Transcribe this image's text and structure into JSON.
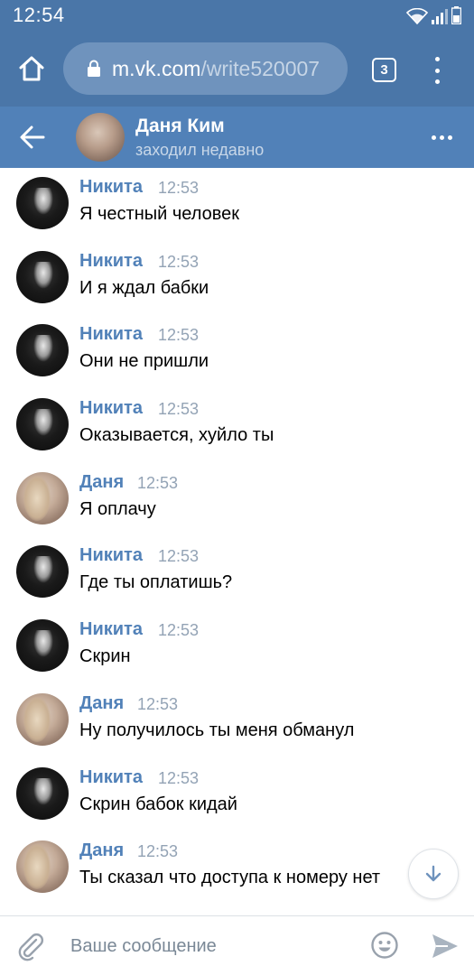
{
  "status_bar": {
    "time": "12:54"
  },
  "browser": {
    "url_host": "m.vk.com",
    "url_path": "/write520007",
    "tab_count": "3"
  },
  "chat_header": {
    "name": "Даня Ким",
    "status": "заходил недавно"
  },
  "messages": [
    {
      "author": "Никита",
      "time": "12:53",
      "text": "Я честный человек",
      "avatar": "nikita"
    },
    {
      "author": "Никита",
      "time": "12:53",
      "text": "И я ждал бабки",
      "avatar": "nikita"
    },
    {
      "author": "Никита",
      "time": "12:53",
      "text": "Они не пришли",
      "avatar": "nikita"
    },
    {
      "author": "Никита",
      "time": "12:53",
      "text": "Оказывается, хуйло ты",
      "avatar": "nikita"
    },
    {
      "author": "Даня",
      "time": "12:53",
      "text": "Я оплачу",
      "avatar": "danya"
    },
    {
      "author": "Никита",
      "time": "12:53",
      "text": "Где ты оплатишь?",
      "avatar": "nikita"
    },
    {
      "author": "Никита",
      "time": "12:53",
      "text": "Скрин",
      "avatar": "nikita"
    },
    {
      "author": "Даня",
      "time": "12:53",
      "text": "Ну получилось ты меня обманул",
      "avatar": "danya"
    },
    {
      "author": "Никита",
      "time": "12:53",
      "text": "Скрин бабок кидай",
      "avatar": "nikita"
    },
    {
      "author": "Даня",
      "time": "12:53",
      "text": "Ты сказал что доступа к номеру нет",
      "avatar": "danya"
    }
  ],
  "composer": {
    "placeholder": "Ваше сообщение"
  },
  "colors": {
    "header_blue": "#4a76a8",
    "chat_header_blue": "#5181b8",
    "author_blue": "#5181b8",
    "time_gray": "#93a3b5"
  },
  "icons": {
    "home": "home-icon",
    "lock": "lock-icon",
    "tabs": "tabs-icon",
    "menu": "kebab-menu-icon",
    "back": "back-arrow-icon",
    "more": "more-icon",
    "scroll_down": "arrow-down-icon",
    "attach": "paperclip-icon",
    "emoji": "emoji-icon",
    "send": "send-icon"
  }
}
